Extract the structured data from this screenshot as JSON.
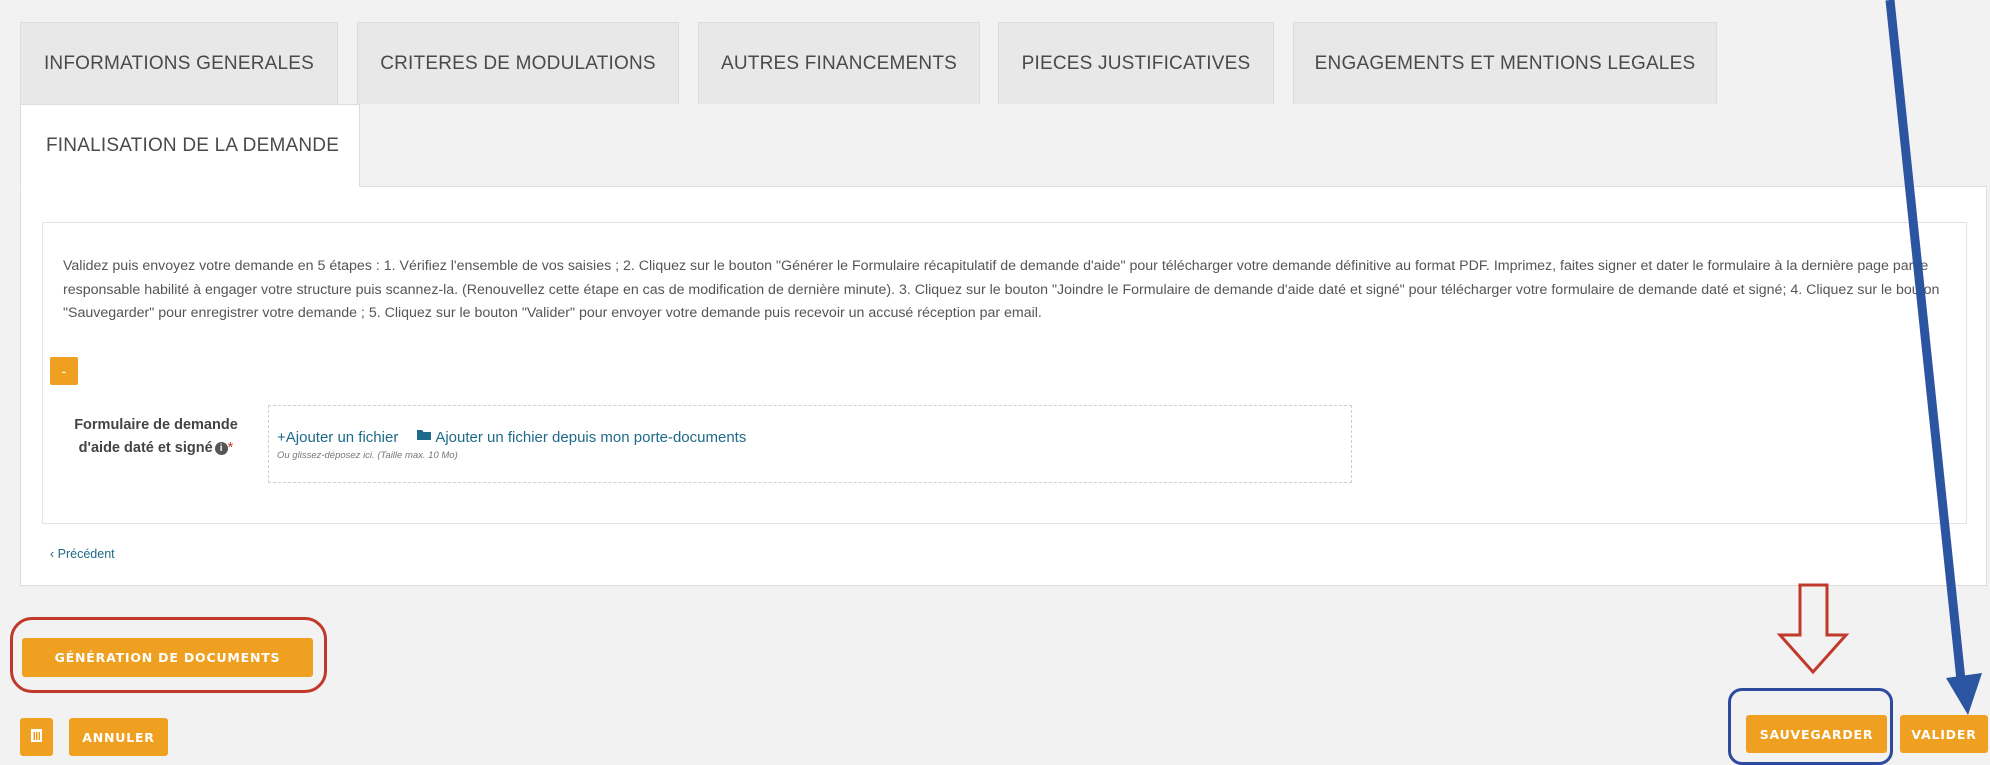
{
  "tabs": [
    {
      "label": "INFORMATIONS GENERALES"
    },
    {
      "label": "CRITERES DE MODULATIONS"
    },
    {
      "label": "AUTRES FINANCEMENTS"
    },
    {
      "label": "PIECES JUSTIFICATIVES"
    },
    {
      "label": "ENGAGEMENTS ET MENTIONS LEGALES"
    },
    {
      "label": "FINALISATION DE LA DEMANDE",
      "active": true
    }
  ],
  "panel": {
    "instructions": "Validez puis envoyez votre demande en 5 étapes : 1. Vérifiez l'ensemble de vos saisies ; 2. Cliquez sur le bouton \"Générer le Formulaire récapitulatif de demande d'aide\" pour télécharger votre demande définitive au format PDF. Imprimez, faites signer et dater le formulaire à la dernière page par le responsable habilité à engager votre structure puis scannez-la. (Renouvellez cette étape en cas de modification de dernière minute). 3. Cliquez sur le bouton \"Joindre le Formulaire de demande d'aide daté et signé\" pour télécharger votre formulaire de demande daté et signé; 4. Cliquez sur le bouton \"Sauvegarder\" pour enregistrer votre demande ; 5. Cliquez sur le bouton \"Valider\" pour envoyer votre demande puis recevoir un accusé réception par email.",
    "toggle_label": "-",
    "field_label_line1": "Formulaire de demande",
    "field_label_line2": "d'aide daté et signé",
    "required_mark": "*",
    "add_file": "+Ajouter un fichier",
    "add_from_portfolio": "Ajouter un fichier depuis mon porte-documents",
    "dropzone_hint": "Ou glissez-déposez ici. (Taille max. 10 Mo)",
    "previous": "Précédent"
  },
  "actions": {
    "generate_docs": "GÉNÉRATION DE DOCUMENTS",
    "cancel": "ANNULER",
    "save": "SAUVEGARDER",
    "validate": "VALIDER"
  },
  "colors": {
    "accent_orange": "#f0a020",
    "annotation_blue": "#2e4a9e",
    "annotation_red": "#c0392b",
    "arrow_blue": "#2b55a0"
  },
  "icons": [
    "info-icon",
    "folder-icon",
    "trash-icon",
    "chevron-left-icon"
  ]
}
